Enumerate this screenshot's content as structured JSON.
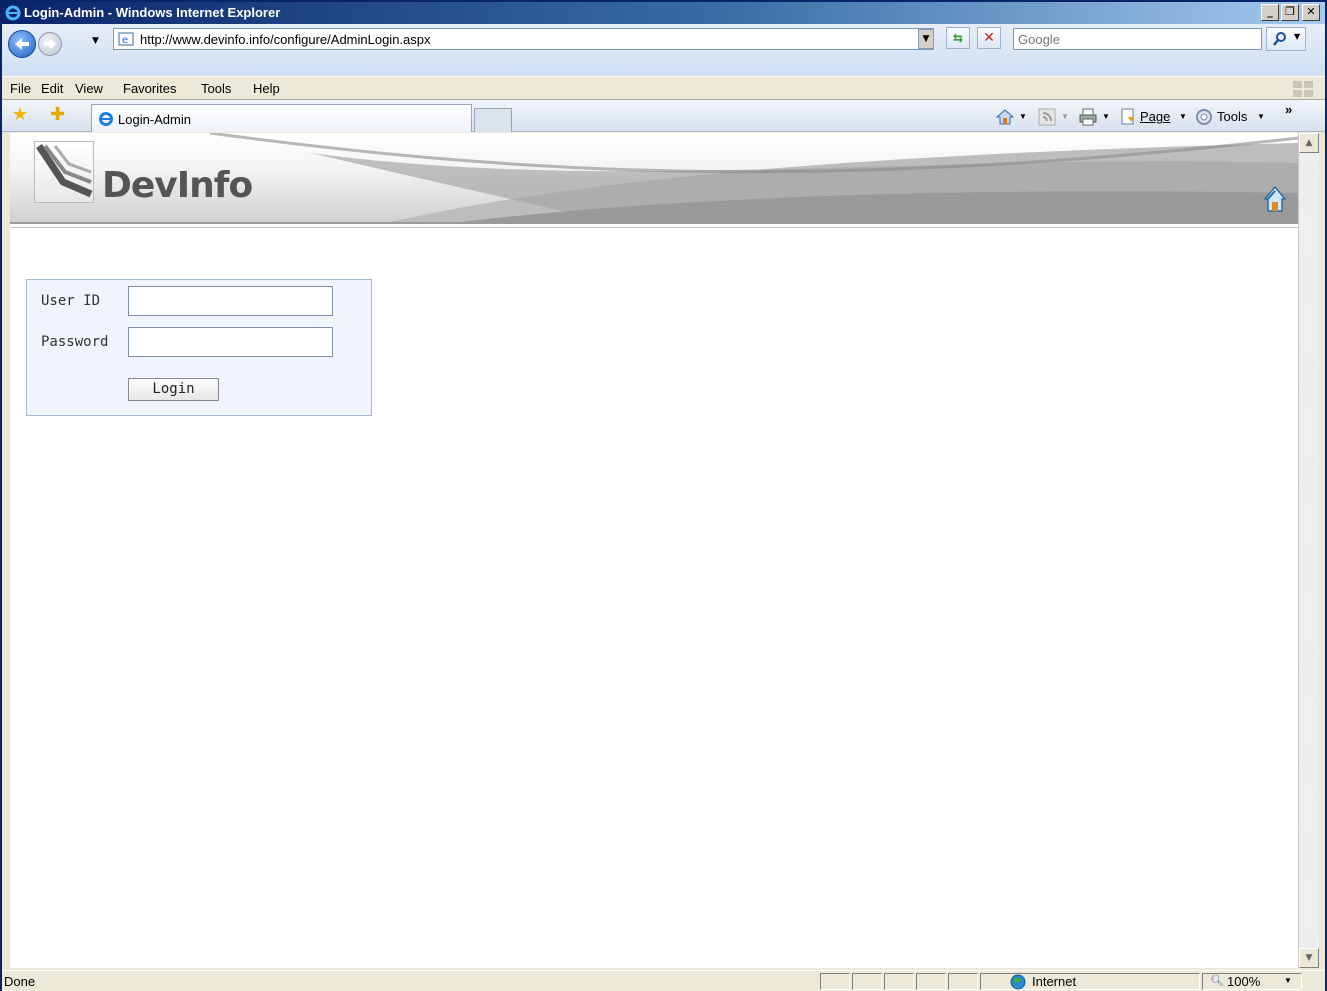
{
  "window": {
    "title": "Login-Admin - Windows Internet Explorer",
    "minimize": "_",
    "maximize": "❐",
    "close": "✕"
  },
  "address": {
    "url": "http://www.devinfo.info/configure/AdminLogin.aspx",
    "search_placeholder": "Google"
  },
  "menu": {
    "items": [
      "File",
      "Edit",
      "View",
      "Favorites",
      "Tools",
      "Help"
    ]
  },
  "tabs": {
    "active_label": "Login-Admin"
  },
  "command_bar": {
    "page_label": "Page",
    "tools_label": "Tools",
    "overflow": "»"
  },
  "site": {
    "logo_text": "DevInfo"
  },
  "login": {
    "user_id_label": "User ID",
    "password_label": "Password",
    "user_id_value": "",
    "password_value": "",
    "submit_label": "Login"
  },
  "status": {
    "text": "Done",
    "zone": "Internet",
    "zoom": "100%"
  },
  "colors": {
    "title_bar": "#0a246a",
    "panel_bg": "#f0f4fc",
    "panel_border": "#a6b8d6"
  }
}
